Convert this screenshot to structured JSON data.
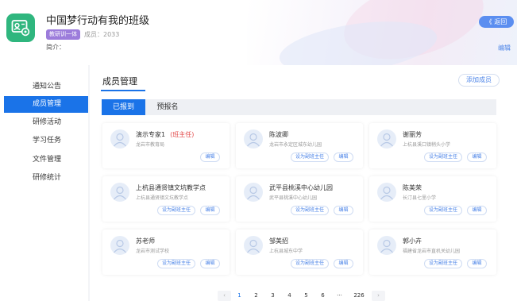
{
  "header": {
    "class_title": "中国梦行动有我的班级",
    "badge": "教研训一体",
    "member_count": "成员：2033",
    "intro_label": "简介：",
    "back_button": "《 返回",
    "edit_label": "编辑"
  },
  "sidebar": {
    "items": [
      {
        "label": "通知公告"
      },
      {
        "label": "成员管理"
      },
      {
        "label": "研修活动"
      },
      {
        "label": "学习任务"
      },
      {
        "label": "文件管理"
      },
      {
        "label": "研修统计"
      }
    ],
    "active_index": 1
  },
  "main": {
    "title": "成员管理",
    "add_button": "添加成员",
    "tabs": [
      {
        "label": "已报到"
      },
      {
        "label": "预报名"
      }
    ]
  },
  "members": [
    {
      "name": "演示专家1",
      "role": "(班主任)",
      "org": "龙岩市教育局",
      "deputy": "",
      "edit": "编辑"
    },
    {
      "name": "陈波卿",
      "role": "",
      "org": "龙岩市永定区城东幼儿园",
      "deputy": "设为副班主任",
      "edit": "编辑"
    },
    {
      "name": "谢丽芳",
      "role": "",
      "org": "上杭县溪口镇稍头小学",
      "deputy": "设为副班主任",
      "edit": "编辑"
    },
    {
      "name": "上杭县通贤镇文坑教学点",
      "role": "",
      "org": "上杭县通贤镇文坑教学点",
      "deputy": "设为副班主任",
      "edit": "编辑"
    },
    {
      "name": "武平县桃溪中心幼儿园",
      "role": "",
      "org": "武平县桃溪中心幼儿园",
      "deputy": "设为副班主任",
      "edit": "编辑"
    },
    {
      "name": "陈美荣",
      "role": "",
      "org": "长汀县七里小学",
      "deputy": "设为副班主任",
      "edit": "编辑"
    },
    {
      "name": "苏老师",
      "role": "",
      "org": "龙岩市测试学校",
      "deputy": "设为副班主任",
      "edit": "编辑"
    },
    {
      "name": "邹美招",
      "role": "",
      "org": "上杭县城东中学",
      "deputy": "设为副班主任",
      "edit": "编辑"
    },
    {
      "name": "郭小卉",
      "role": "",
      "org": "福建省龙岩市直机关幼儿园",
      "deputy": "设为副班主任",
      "edit": "编辑"
    }
  ],
  "pagination": {
    "prev": "‹",
    "pages": [
      "1",
      "2",
      "3",
      "4",
      "5",
      "6",
      "···",
      "226"
    ],
    "next": "›",
    "current": "1"
  },
  "colors": {
    "accent": "#1a73e8",
    "badge": "#9c7cdb",
    "avatar": "#2fb67e",
    "role": "#e34d4d"
  },
  "icons": {
    "class_avatar": "id-card-gear-icon",
    "member_avatar": "user-icon"
  }
}
